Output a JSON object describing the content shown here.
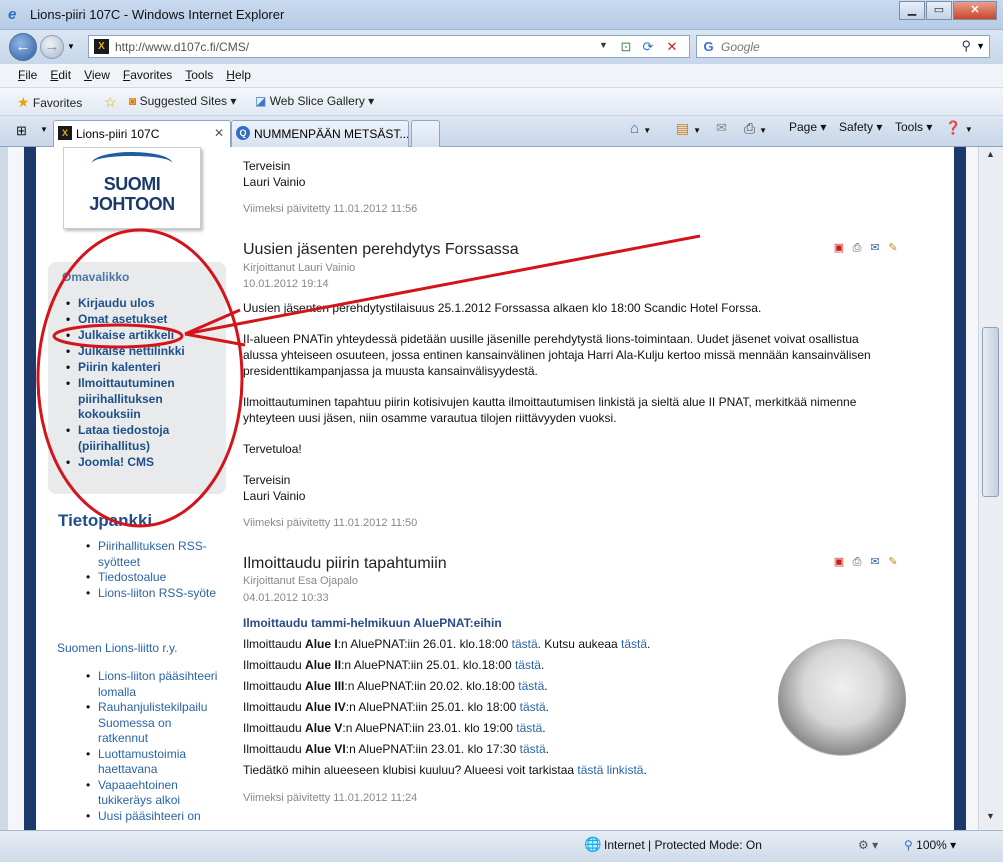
{
  "window": {
    "title": "Lions-piiri 107C - Windows Internet Explorer"
  },
  "address": {
    "url": "http://www.d107c.fi/CMS/",
    "search_placeholder": "Google"
  },
  "menu": [
    "File",
    "Edit",
    "View",
    "Favorites",
    "Tools",
    "Help"
  ],
  "favbar": {
    "favorites": "Favorites",
    "suggested": "Suggested Sites",
    "webslice": "Web Slice Gallery"
  },
  "tabs": [
    {
      "label": "Lions-piiri 107C"
    },
    {
      "label": "NUMMENPÄÄN METSÄST..."
    }
  ],
  "command_bar": {
    "page": "Page",
    "safety": "Safety",
    "tools": "Tools"
  },
  "sidebar": {
    "logo": {
      "line1": "SUOMI",
      "line2": "JOHTOON"
    },
    "panel_title": "Omavalikko",
    "user_menu": [
      "Kirjaudu ulos",
      "Omat asetukset",
      "Julkaise artikkeli",
      "Julkaise nettilinkki",
      "Piirin kalenteri",
      "Ilmoittautuminen piirihallituksen kokouksiin",
      "Lataa tiedostoja (piirihallitus)",
      "Joomla! CMS"
    ],
    "tietopankki": {
      "title": "Tietopankki",
      "items": [
        "Piirihallituksen RSS-syötteet",
        "Tiedostoalue",
        "Lions-liiton RSS-syöte"
      ]
    },
    "liitto": {
      "title": "Suomen Lions-liitto r.y.",
      "items": [
        "Lions-liiton pääsihteeri lomalla",
        "Rauhanjulistekilpailu Suomessa on ratkennut",
        "Luottamustoimia haettavana",
        "Vapaaehtoinen tukikeräys alkoi",
        "Uusi pääsihteeri on"
      ]
    }
  },
  "articles": {
    "top": {
      "greeting": "Terveisin",
      "signature": "Lauri Vainio",
      "updated": "Viimeksi päivitetty 11.01.2012 11:56"
    },
    "a1": {
      "title": "Uusien jäsenten perehdytys Forssassa",
      "author": "Kirjoittanut Lauri Vainio",
      "date": "10.01.2012 19:14",
      "p1": "Uusien jäsenten perehdytystilaisuus 25.1.2012 Forssassa alkaen klo 18:00 Scandic Hotel Forssa.",
      "p2a": "II-alueen PNATin yhteydessä pidetään uusille jäsenille perehdytystä lions-toimintaan. Uudet jäsenet voivat osallistua",
      "p2b": "alussa yhteiseen osuuteen, jossa entinen kansainvälinen johtaja Harri Ala-Kulju kertoo missä mennään kansainvälisen",
      "p2c": "presidenttikampanjassa ja muusta kansainvälisyydestä.",
      "p3a": "Ilmoittautuminen tapahtuu piirin kotisivujen kautta ilmoittautumisen linkistä ja sieltä alue II PNAT, merkitkää nimenne",
      "p3b": "yhteyteen uusi jäsen, niin osamme varautua tilojen riittävyyden vuoksi.",
      "p4": "Tervetuloa!",
      "greeting": "Terveisin",
      "signature": "Lauri Vainio",
      "updated": "Viimeksi päivitetty 11.01.2012 11:50"
    },
    "a2": {
      "title": "Ilmoittaudu piirin tapahtumiin",
      "author": "Kirjoittanut Esa Ojapalo",
      "date": "04.01.2012 10:33",
      "subtitle": "Ilmoittaudu tammi-helmikuun AluePNAT:eihin",
      "lines": [
        {
          "pre": "Ilmoittaudu ",
          "bold": "Alue I",
          "post": ":n AluePNAT:iin 26.01. klo.18:00 ",
          "link": "tästä",
          "extra": ". Kutsu aukeaa ",
          "link2": "tästä",
          "end": "."
        },
        {
          "pre": "Ilmoittaudu ",
          "bold": "Alue II",
          "post": ":n AluePNAT:iin 25.01. klo.18:00 ",
          "link": "tästä",
          "end": "."
        },
        {
          "pre": "Ilmoittaudu ",
          "bold": "Alue III",
          "post": ":n AluePNAT:iin 20.02. klo.18:00 ",
          "link": "tästä",
          "end": "."
        },
        {
          "pre": "Ilmoittaudu ",
          "bold": "Alue IV",
          "post": ":n AluePNAT:iin 25.01. klo 18:00 ",
          "link": "tästä",
          "end": "."
        },
        {
          "pre": "Ilmoittaudu ",
          "bold": "Alue V",
          "post": ":n AluePNAT:iin 23.01. klo 19:00 ",
          "link": "tästä",
          "end": "."
        },
        {
          "pre": "Ilmoittaudu ",
          "bold": "Alue VI",
          "post": ":n AluePNAT:iin 23.01. klo 17:30 ",
          "link": "tästä",
          "end": "."
        }
      ],
      "question": "Tiedätkö mihin alueeseen klubisi kuuluu?  Alueesi voit tarkistaa ",
      "question_link": "tästä linkistä",
      "question_end": ".",
      "updated": "Viimeksi päivitetty 11.01.2012 11:24"
    }
  },
  "status": {
    "zone": "Internet | Protected Mode: On",
    "zoom": "100%"
  },
  "colors": {
    "annotation": "#d4141b",
    "link": "#2a64a6",
    "sidebar_link": "#1d4f8a",
    "frame": "#1b3a6b"
  }
}
